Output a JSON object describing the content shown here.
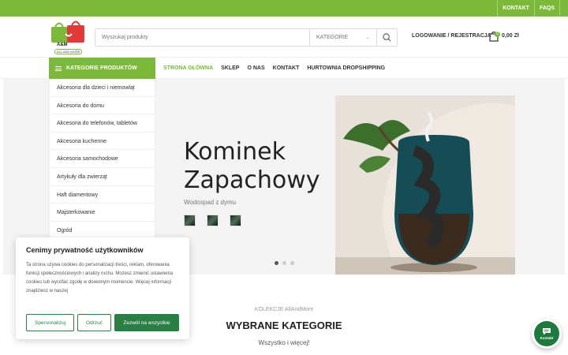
{
  "topbar": {
    "links": [
      "KONTAKT",
      "FAQS"
    ]
  },
  "header": {
    "logo_text": "A&M",
    "logo_sub": "ALL AND MORE",
    "search_placeholder": "Wyszukaj produkty",
    "category_select": "KATEGORIE",
    "login_label": "LOGOWANIE / REJESTRACJA",
    "cart_count": "0",
    "cart_total": "0,00 Zł"
  },
  "nav": {
    "categories_button": "KATEGORIE PRODUKTÓW",
    "menu": [
      "STRONA GŁÓWNA",
      "SKLEP",
      "O NAS",
      "KONTAKT",
      "HURTOWNIA DROPSHIPPING"
    ]
  },
  "sidebar": {
    "items": [
      "Akcesoria dla dzieci i niemowląt",
      "Akcesoria do domu",
      "Akcesoria do telefonów, tabletów",
      "Akcesoria kuchenne",
      "Akcesoria samochodowe",
      "Artykuły dla zwierząt",
      "Haft diamentowy",
      "Majsterkowanie",
      "Ogród"
    ]
  },
  "hero": {
    "title_line1": "Kominek",
    "title_line2": "Zapachowy",
    "subtitle": "Wodospad z dymu",
    "active_slide": 1,
    "slides": 3
  },
  "cookie": {
    "title": "Cenimy prywatność użytkowników",
    "text": "Ta strona używa cookies do personalizacji treści, reklam, oferowania funkcji społecznościowych i analizy ruchu. Możesz zmienić ustawienia cookies lub wycofać zgodę w dowolnym momencie. Więcej informacji znajdziesz w naszej",
    "btn_customize": "Spersonalizuj",
    "btn_reject": "Odrzuć",
    "btn_accept": "Zezwól na wszystkie"
  },
  "section": {
    "eyebrow": "KOLEKCJE AllAndMore",
    "title": "WYBRANE KATEGORIE",
    "subtitle": "Wszystko i więcej!"
  },
  "chat": {
    "label": "Kontakt"
  },
  "colors": {
    "brand_green": "#7cb83a",
    "cookie_green": "#2a7f45"
  }
}
